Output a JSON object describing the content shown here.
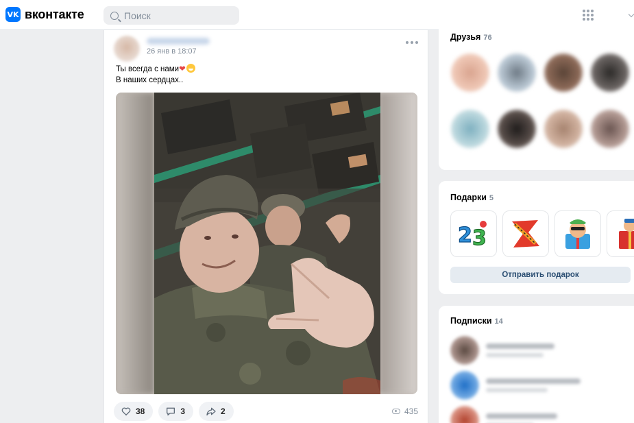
{
  "header": {
    "logo_mark": "VK",
    "logo_text": "вконтакте",
    "search_placeholder": "Поиск"
  },
  "post": {
    "time": "26 янв в 18:07",
    "text_line1": "Ты всегда с нами",
    "text_line1_emoji": "❤",
    "text_line2": "В наших сердцах..",
    "likes": "38",
    "comments": "3",
    "shares": "2",
    "views": "435"
  },
  "friends": {
    "title": "Друзья",
    "count": "76"
  },
  "gifts": {
    "title": "Подарки",
    "count": "5",
    "send_label": "Отправить подарок"
  },
  "subscriptions": {
    "title": "Подписки",
    "count": "14"
  },
  "colors": {
    "brand": "#0077ff",
    "page_bg": "#edeef0",
    "muted": "#818c99",
    "button_text": "#2c4f73"
  }
}
